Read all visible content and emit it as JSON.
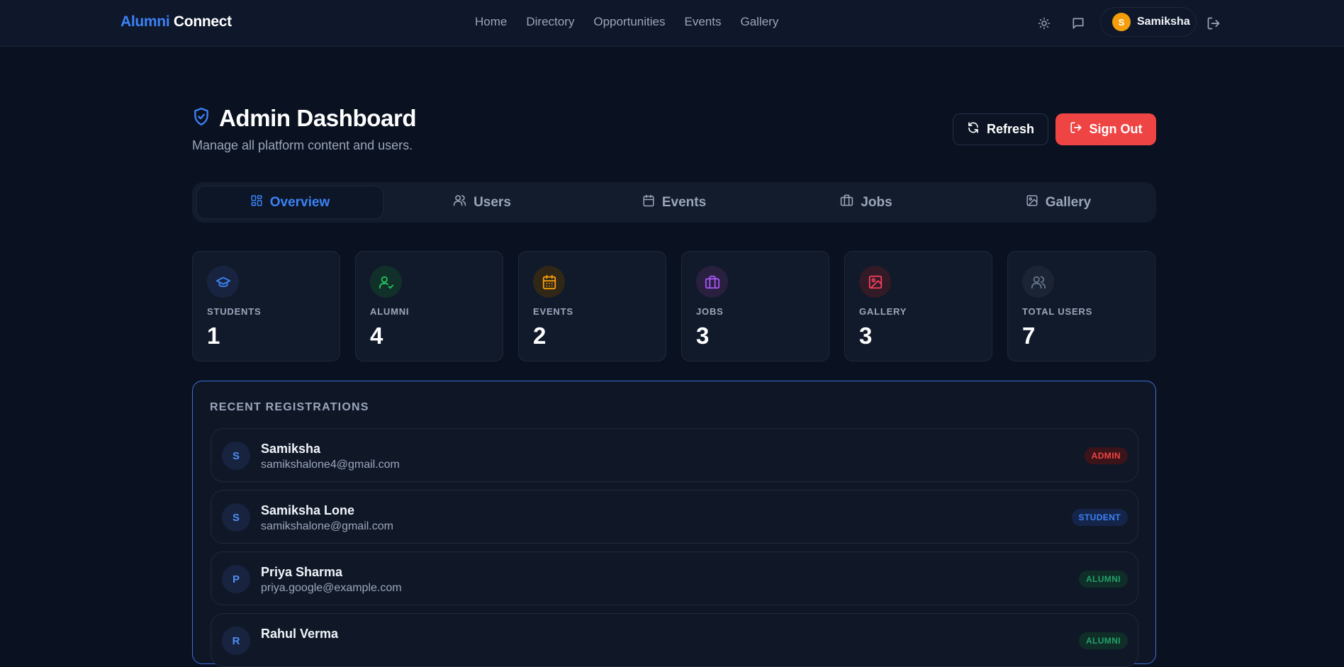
{
  "navbar": {
    "brand_part1": "Alumni",
    "brand_part2": "Connect",
    "links": [
      "Home",
      "Directory",
      "Opportunities",
      "Events",
      "Gallery"
    ],
    "icons": [
      "sun-icon",
      "message-icon",
      "logout-icon"
    ],
    "user": {
      "initial": "S",
      "name": "Samiksha",
      "avatar_color": "#f59e0b"
    }
  },
  "header": {
    "title": "Admin Dashboard",
    "subtitle": "Manage all platform content and users.",
    "refresh_label": "Refresh",
    "signout_label": "Sign Out"
  },
  "tabs": [
    {
      "label": "Overview",
      "icon": "grid-icon",
      "active": true
    },
    {
      "label": "Users",
      "icon": "users-icon",
      "active": false
    },
    {
      "label": "Events",
      "icon": "calendar-icon",
      "active": false
    },
    {
      "label": "Jobs",
      "icon": "briefcase-icon",
      "active": false
    },
    {
      "label": "Gallery",
      "icon": "image-icon",
      "active": false
    }
  ],
  "stats": [
    {
      "label": "STUDENTS",
      "value": "1",
      "icon": "graduation-cap-icon",
      "color": "#3b82f6"
    },
    {
      "label": "ALUMNI",
      "value": "4",
      "icon": "user-check-icon",
      "color": "#22c55e"
    },
    {
      "label": "EVENTS",
      "value": "2",
      "icon": "calendar-icon",
      "color": "#f59e0b"
    },
    {
      "label": "JOBS",
      "value": "3",
      "icon": "briefcase-icon",
      "color": "#a855f7"
    },
    {
      "label": "GALLERY",
      "value": "3",
      "icon": "image-icon",
      "color": "#f43f5e"
    },
    {
      "label": "TOTAL USERS",
      "value": "7",
      "icon": "users-icon",
      "color": "#64748b"
    }
  ],
  "recent": {
    "title": "RECENT REGISTRATIONS",
    "rows": [
      {
        "initial": "S",
        "name": "Samiksha",
        "email": "samikshalone4@gmail.com",
        "role": "ADMIN"
      },
      {
        "initial": "S",
        "name": "Samiksha Lone",
        "email": "samikshalone@gmail.com",
        "role": "STUDENT"
      },
      {
        "initial": "P",
        "name": "Priya Sharma",
        "email": "priya.google@example.com",
        "role": "ALUMNI"
      },
      {
        "initial": "R",
        "name": "Rahul Verma",
        "email": "",
        "role": "ALUMNI"
      }
    ]
  }
}
